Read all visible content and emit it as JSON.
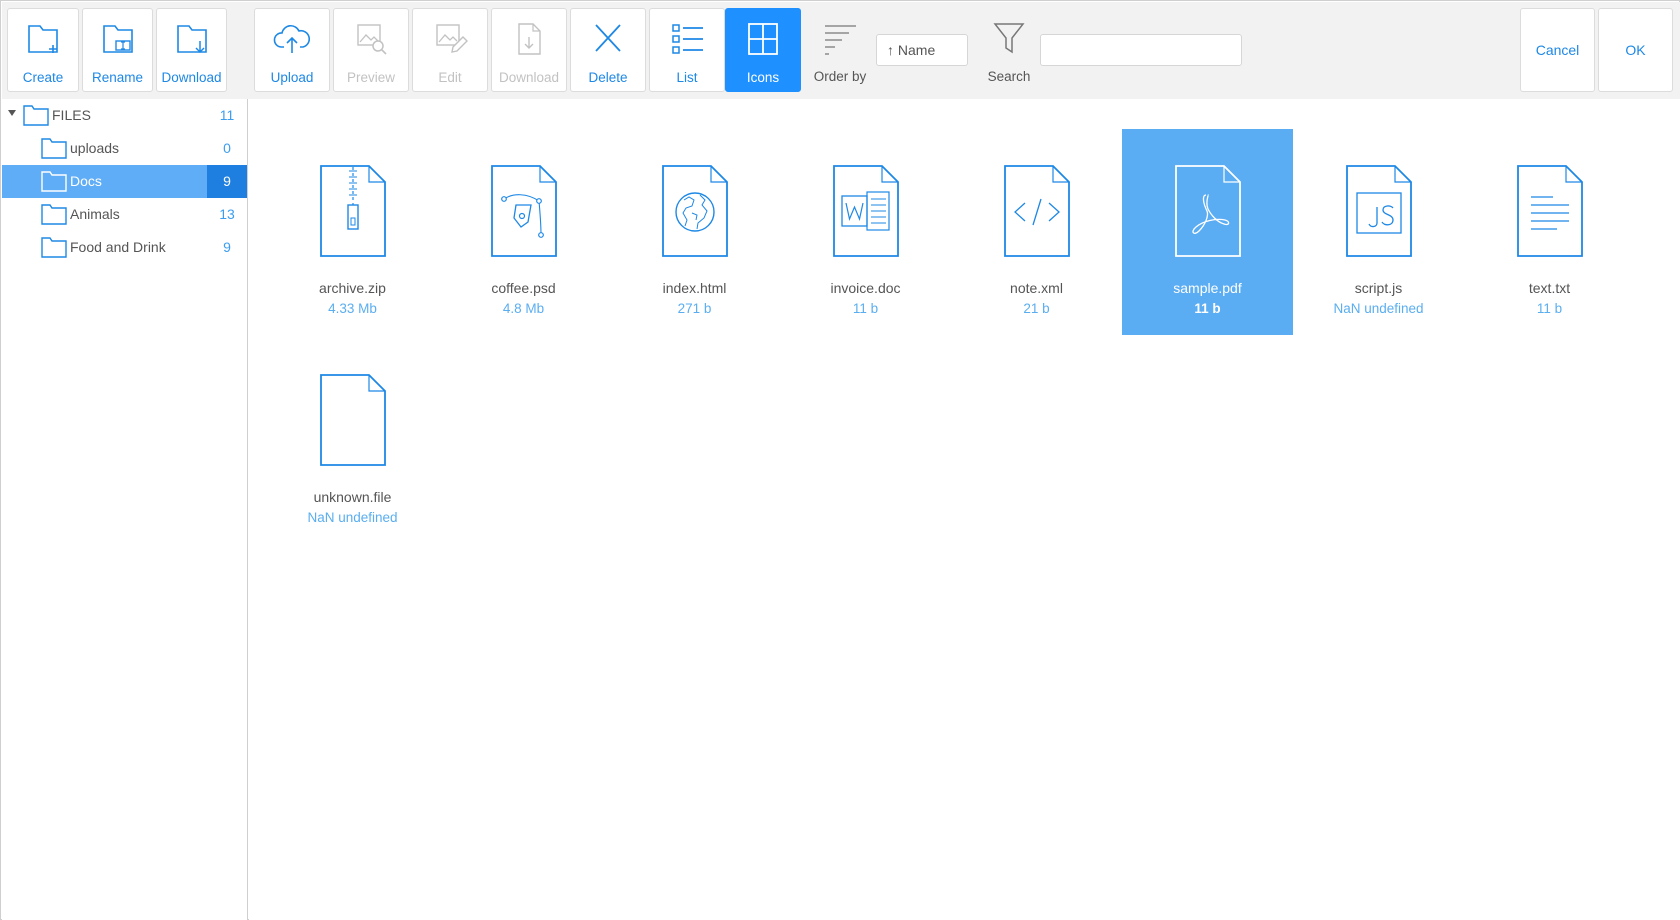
{
  "colors": {
    "accent": "#1e90ff",
    "selection": "#5aacf3",
    "disabled": "#c2c2c2",
    "toolbar_bg": "#f2f2f2"
  },
  "toolbar": {
    "create_label": "Create",
    "rename_label": "Rename",
    "download_label": "Download",
    "upload_label": "Upload",
    "preview_label": "Preview",
    "edit_label": "Edit",
    "download2_label": "Download",
    "delete_label": "Delete",
    "list_label": "List",
    "icons_label": "Icons",
    "order_by_label": "Order by",
    "order_value": "↑ Name",
    "search_label": "Search",
    "search_value": "",
    "cancel_label": "Cancel",
    "ok_label": "OK",
    "icons": [
      "folder-plus-icon",
      "folder-rename-icon",
      "folder-download-icon",
      "cloud-upload-icon",
      "image-search-icon",
      "image-edit-icon",
      "file-download-icon",
      "close-icon",
      "list-view-icon",
      "grid-view-icon",
      "sort-icon",
      "filter-icon"
    ]
  },
  "tree": {
    "root": {
      "label": "FILES",
      "count": "11"
    },
    "children": [
      {
        "label": "uploads",
        "count": "0",
        "selected": false
      },
      {
        "label": "Docs",
        "count": "9",
        "selected": true
      },
      {
        "label": "Animals",
        "count": "13",
        "selected": false
      },
      {
        "label": "Food and Drink",
        "count": "9",
        "selected": false
      }
    ]
  },
  "files": [
    {
      "name": "archive.zip",
      "size": "4.33 Mb",
      "icon": "zip-file-icon"
    },
    {
      "name": "coffee.psd",
      "size": "4.8 Mb",
      "icon": "psd-file-icon"
    },
    {
      "name": "index.html",
      "size": "271 b",
      "icon": "html-file-icon"
    },
    {
      "name": "invoice.doc",
      "size": "11 b",
      "icon": "word-file-icon"
    },
    {
      "name": "note.xml",
      "size": "21 b",
      "icon": "xml-file-icon"
    },
    {
      "name": "sample.pdf",
      "size": "11 b",
      "icon": "pdf-file-icon",
      "selected": true
    },
    {
      "name": "script.js",
      "size": "NaN undefined",
      "icon": "js-file-icon"
    },
    {
      "name": "text.txt",
      "size": "11 b",
      "icon": "text-file-icon"
    },
    {
      "name": "unknown.file",
      "size": "NaN undefined",
      "icon": "blank-file-icon"
    }
  ]
}
